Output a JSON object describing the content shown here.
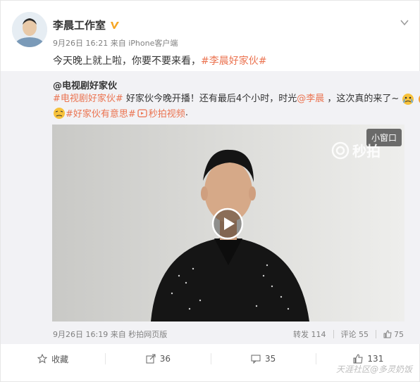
{
  "post": {
    "author": "李晨工作室",
    "time": "9月26日 16:21",
    "source_prefix": "来自",
    "source": "iPhone客户端",
    "text": "今天晚上就上啦，你要不要来看，",
    "tag": "#李晨好家伙#"
  },
  "repost": {
    "author": "@电视剧好家伙",
    "line1_tag": "#电视剧好家伙#",
    "line1_text": " 好家伙今晚开播！还有最后4个小时，时光",
    "line1_mention": "@李晨",
    "line1_text2": " ，这次真的来了~",
    "line2_tag": "#好家伙有意思#",
    "line2_link": "秒拍视频",
    "line2_end": ".",
    "time": "9月26日 16:19",
    "source_prefix": "来自",
    "source": "秒拍网页版",
    "stats": {
      "forward_label": "转发",
      "forward": "114",
      "comment_label": "评论",
      "comment": "55",
      "like": "75"
    }
  },
  "video": {
    "small_window": "小窗口",
    "watermark": "秒拍"
  },
  "actions": {
    "favorite": "收藏",
    "share": "36",
    "comment": "35",
    "like": "131"
  },
  "footer_watermark": "天涯社区@多灵奶饭",
  "colors": {
    "accent": "#eb7350",
    "gray": "#808080"
  }
}
